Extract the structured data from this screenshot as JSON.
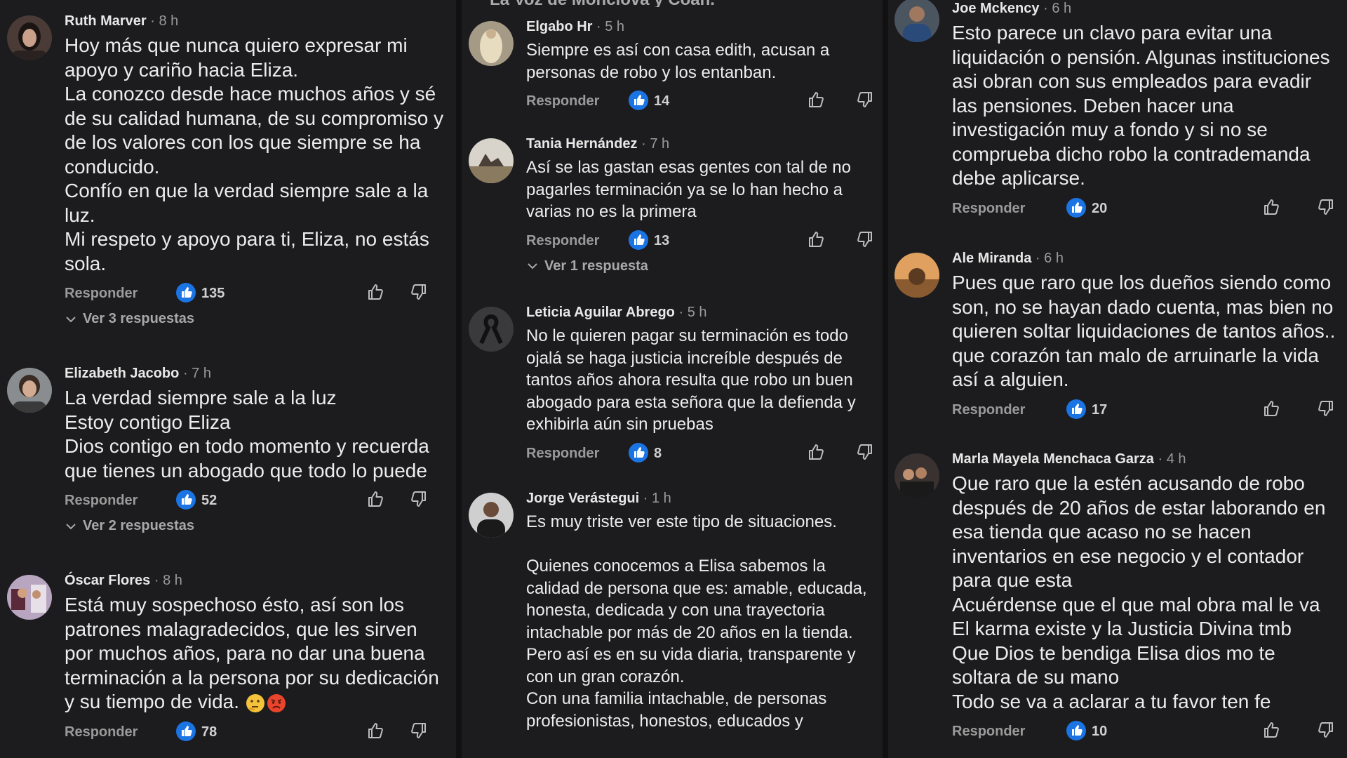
{
  "header": {
    "partial_title": "La Voz de Monclova y Coah."
  },
  "actions": {
    "reply_label": "Responder"
  },
  "columns": [
    {
      "comments": [
        {
          "name": "Ruth Marver",
          "time": "8 h",
          "text": "Hoy más que nunca quiero expresar mi apoyo y cariño hacia Eliza.\nLa conozco desde hace muchos años y sé de su calidad humana, de su compromiso y de los valores con los que siempre se ha conducido.\nConfío en que la verdad siempre sale a la luz.\nMi respeto y apoyo para ti, Eliza, no estás sola.",
          "likes": "135",
          "replies_label": "Ver 3 respuestas"
        },
        {
          "name": "Elizabeth Jacobo",
          "time": "7 h",
          "text": "La verdad siempre sale a la luz\nEstoy contigo Eliza\nDios contigo en todo momento y recuerda que tienes un abogado que todo lo puede",
          "likes": "52",
          "replies_label": "Ver 2 respuestas"
        },
        {
          "name": "Óscar Flores",
          "time": "8 h",
          "text": "Está muy sospechoso ésto, así son los patrones malagradecidos, que les sirven por muchos años, para no dar una buena terminación a la persona por su dedicación y su tiempo de vida.",
          "likes": "78",
          "emojis": [
            "thinking-face-emoji",
            "angry-face-emoji"
          ]
        }
      ]
    },
    {
      "comments": [
        {
          "name": "Elgabo Hr",
          "time": "5 h",
          "text": "Siempre es así con casa edith, acusan a personas de robo y los entanban.",
          "likes": "14"
        },
        {
          "name": "Tania Hernández",
          "time": "7 h",
          "text": "Así se las gastan esas gentes con tal de no pagarles terminación ya se lo han hecho a varias no es la primera",
          "likes": "13",
          "replies_label": "Ver 1 respuesta"
        },
        {
          "name": "Leticia Aguilar Abrego",
          "time": "5 h",
          "text": "No le quieren pagar su terminación es todo ojalá se haga justicia increíble después de tantos años ahora resulta que robo un buen abogado para esta señora que la defienda y exhibirla aún sin pruebas",
          "likes": "8"
        },
        {
          "name": "Jorge Verástegui",
          "time": "1 h",
          "text": "Es muy triste ver este tipo de situaciones.\n\nQuienes conocemos a Elisa sabemos la calidad de persona que es: amable, educada, honesta, dedicada y con una trayectoria intachable por más de 20 años en la tienda.\nPero así es en su vida diaria, transparente y con un gran corazón.\nCon una familia intachable, de personas profesionistas, honestos, educados y"
        }
      ]
    },
    {
      "comments": [
        {
          "name": "Joe Mckency",
          "time": "6 h",
          "text": "Esto parece un clavo para evitar una liquidación o pensión. Algunas instituciones asi obran con sus empleados para evadir las pensiones. Deben hacer una investigación muy a fondo y si no se comprueba dicho robo la contrademanda debe aplicarse.",
          "likes": "20"
        },
        {
          "name": "Ale Miranda",
          "time": "6 h",
          "text": "Pues que raro que los dueños siendo como son, no se hayan dado cuenta, mas bien no quieren soltar liquidaciones de tantos años.. que corazón tan malo de arruinarle la vida así a alguien.",
          "likes": "17"
        },
        {
          "name": "Marla Mayela Menchaca Garza",
          "time": "4 h",
          "text": "Que raro que la estén acusando de robo después de 20 años de estar laborando en esa tienda que acaso no se hacen inventarios en ese negocio y el contador para que esta\nAcuérdense que el que mal obra mal le va\nEl karma existe y la Justicia Divina tmb\nQue Dios te bendiga Elisa dios mo te soltara de su mano\nTodo se va a aclarar a tu favor ten fe",
          "likes": "10"
        }
      ]
    }
  ],
  "colors": {
    "background": "#1c1c1e",
    "like_badge": "#1b74e4",
    "muted_text": "#9a9a9a"
  }
}
